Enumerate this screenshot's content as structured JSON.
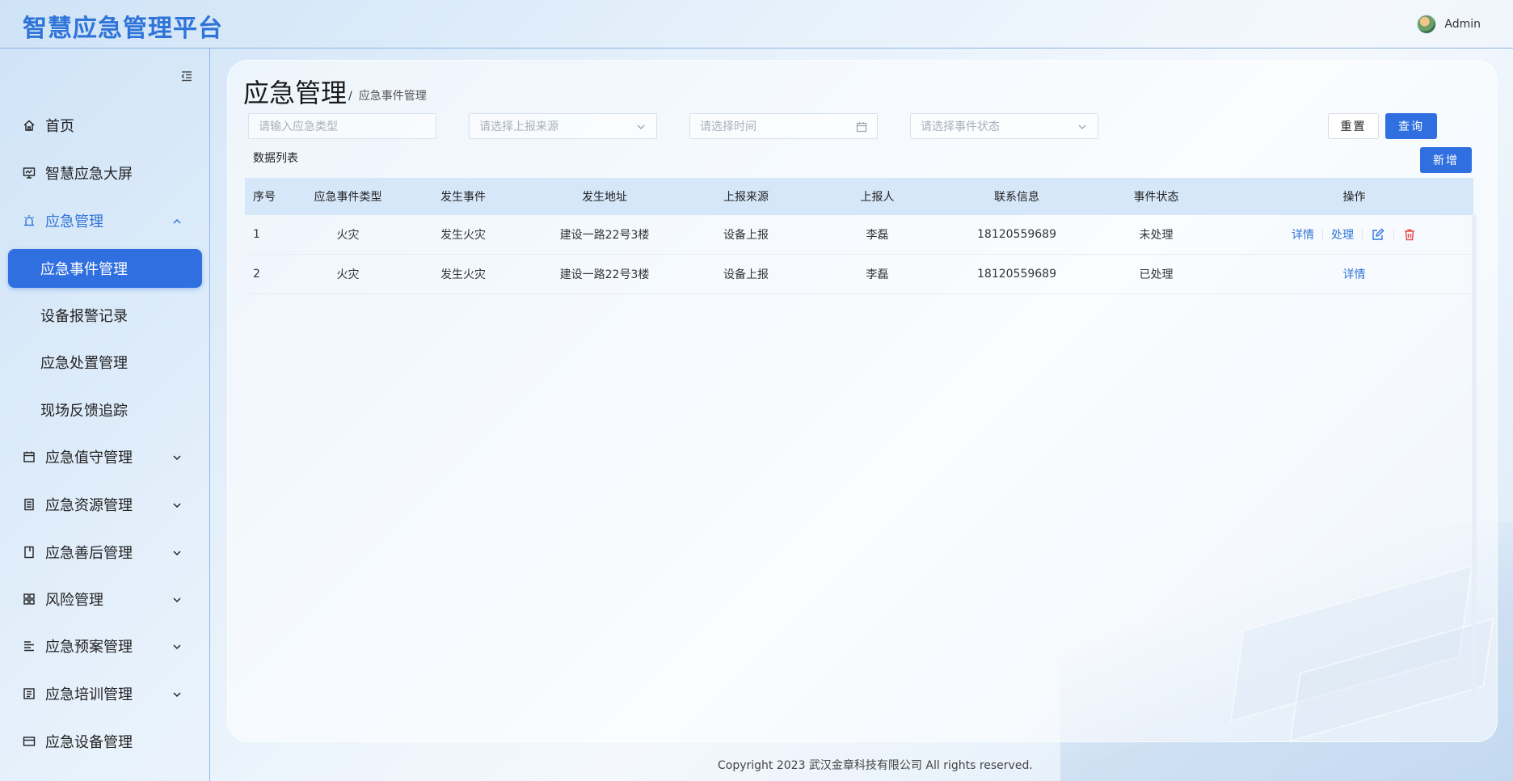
{
  "header": {
    "app_title": "智慧应急管理平台",
    "user_name": "Admin"
  },
  "sidebar": {
    "items": [
      {
        "label": "首页",
        "icon": "home-icon"
      },
      {
        "label": "智慧应急大屏",
        "icon": "monitor-icon"
      },
      {
        "label": "应急管理",
        "icon": "alarm-icon",
        "expanded": true
      },
      {
        "label": "应急事件管理",
        "active": true
      },
      {
        "label": "设备报警记录"
      },
      {
        "label": "应急处置管理"
      },
      {
        "label": "现场反馈追踪"
      },
      {
        "label": "应急值守管理",
        "icon": "calendar-icon"
      },
      {
        "label": "应急资源管理",
        "icon": "document-icon"
      },
      {
        "label": "应急善后管理",
        "icon": "book-icon"
      },
      {
        "label": "风险管理",
        "icon": "grid-icon"
      },
      {
        "label": "应急预案管理",
        "icon": "list-icon"
      },
      {
        "label": "应急培训管理",
        "icon": "checklist-icon"
      },
      {
        "label": "应急设备管理",
        "icon": "card-icon"
      }
    ]
  },
  "page": {
    "title": "应急管理",
    "breadcrumb_sep": "/",
    "breadcrumb": "应急事件管理"
  },
  "filters": {
    "type_placeholder": "请输入应急类型",
    "source_placeholder": "请选择上报来源",
    "time_placeholder": "请选择时间",
    "status_placeholder": "请选择事件状态"
  },
  "buttons": {
    "reset": "重置",
    "query": "查询",
    "add": "新增"
  },
  "list_title": "数据列表",
  "table": {
    "columns": [
      "序号",
      "应急事件类型",
      "发生事件",
      "发生地址",
      "上报来源",
      "上报人",
      "联系信息",
      "事件状态",
      "操作"
    ],
    "rows": [
      {
        "no": "1",
        "type": "火灾",
        "event": "发生火灾",
        "address": "建设一路22号3楼",
        "source": "设备上报",
        "reporter": "李磊",
        "contact": "18120559689",
        "status": "未处理"
      },
      {
        "no": "2",
        "type": "火灾",
        "event": "发生火灾",
        "address": "建设一路22号3楼",
        "source": "设备上报",
        "reporter": "李磊",
        "contact": "18120559689",
        "status": "已处理"
      }
    ],
    "actions": {
      "detail": "详情",
      "handle": "处理"
    }
  },
  "footer": "Copyright 2023 武汉金章科技有限公司 All rights reserved.",
  "colors": {
    "accent": "#2f6fe0",
    "link": "#2f74d8",
    "danger": "#e5484d"
  }
}
